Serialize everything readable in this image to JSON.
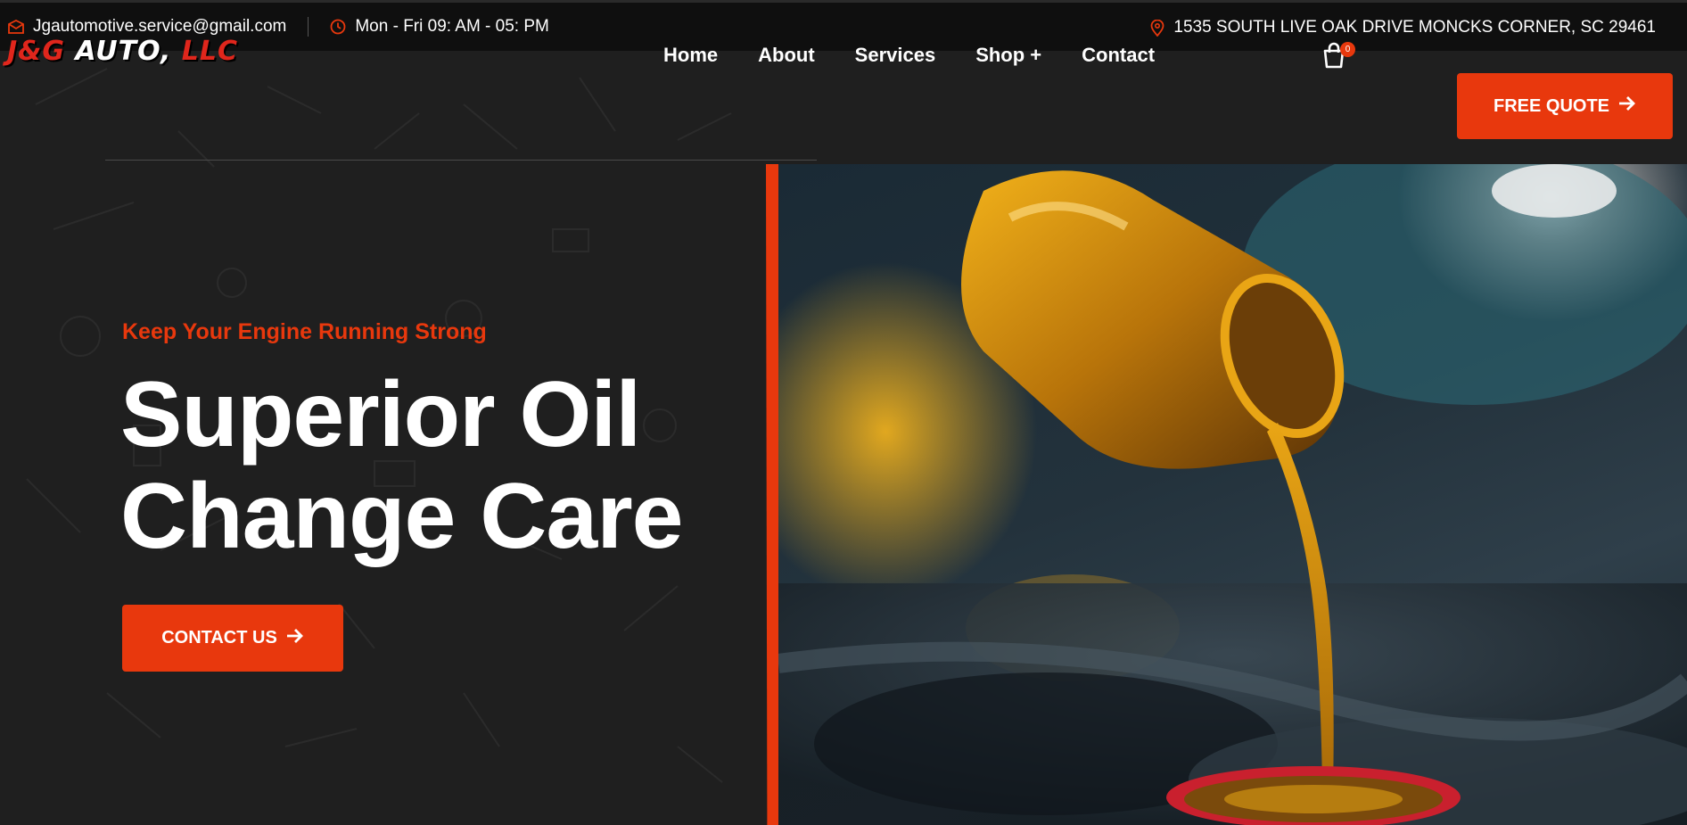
{
  "topbar": {
    "email": "Jgautomotive.service@gmail.com",
    "hours": "Mon - Fri 09: AM - 05: PM",
    "address": "1535 SOUTH LIVE OAK DRIVE MONCKS CORNER, SC 29461",
    "icons": [
      "envelope-icon",
      "clock-icon",
      "map-pin-icon"
    ]
  },
  "brand": {
    "part1": "J&G",
    "part2": "AUTO,",
    "part3": "LLC"
  },
  "nav": {
    "items": [
      "Home",
      "About",
      "Services",
      "Shop +",
      "Contact"
    ]
  },
  "cart": {
    "count": "0"
  },
  "header": {
    "quote_label": "FREE QUOTE"
  },
  "hero": {
    "tagline": "Keep Your Engine Running Strong",
    "headline_line1": "Superior Oil",
    "headline_line2": "Change Care",
    "cta_label": "CONTACT US",
    "image_alt": "Oil being poured into engine"
  },
  "colors": {
    "accent": "#e8380d",
    "background": "#1f1f1f",
    "topbar": "#0f0f0f"
  }
}
